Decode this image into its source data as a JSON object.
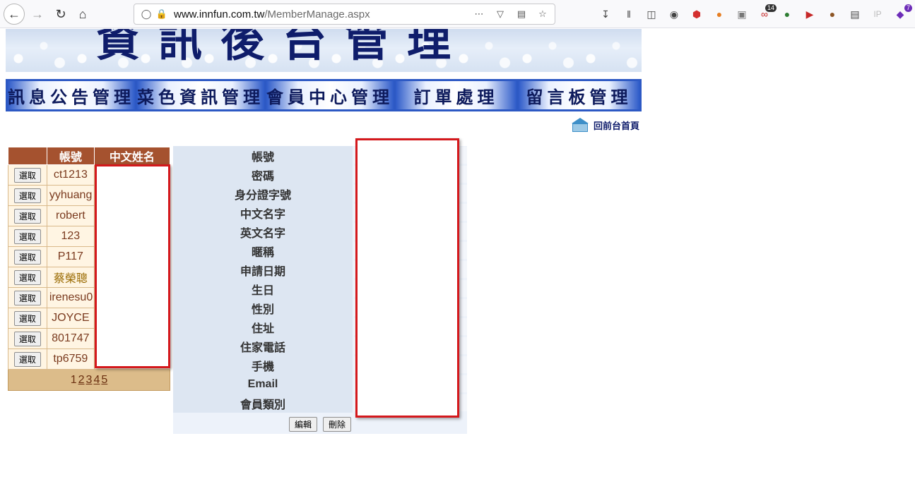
{
  "browser": {
    "url_host": "www.innfun.com.tw",
    "url_path": "/MemberManage.aspx",
    "extension_badges": {
      "count_a": "14",
      "count_b": "7"
    }
  },
  "banner": {
    "title": "資訊後台管理"
  },
  "menu": [
    {
      "label": "訊息公告管理"
    },
    {
      "label": "菜色資訊管理"
    },
    {
      "label": "會員中心管理"
    },
    {
      "label": "訂單處理"
    },
    {
      "label": "留言板管理"
    }
  ],
  "home_link": {
    "label": "回前台首頁"
  },
  "member_list": {
    "headers": [
      "",
      "帳號",
      "中文姓名"
    ],
    "select_label": "選取",
    "rows": [
      {
        "account": "ct1213"
      },
      {
        "account": "yyhuang"
      },
      {
        "account": "robert"
      },
      {
        "account": "123"
      },
      {
        "account": "P117"
      },
      {
        "account": "蔡榮聰"
      },
      {
        "account": "irenesu0"
      },
      {
        "account": "JOYCE"
      },
      {
        "account": "801747"
      },
      {
        "account": "tp6759"
      }
    ],
    "pager": [
      "1",
      "2",
      "3",
      "4",
      "5"
    ]
  },
  "detail": {
    "fields": [
      "帳號",
      "密碼",
      "身分證字號",
      "中文名字",
      "英文名字",
      "暱稱",
      "申請日期",
      "生日",
      "性別",
      "住址",
      "住家電話",
      "手機",
      "Email",
      "會員類別"
    ],
    "edit_label": "編輯",
    "delete_label": "刪除"
  }
}
